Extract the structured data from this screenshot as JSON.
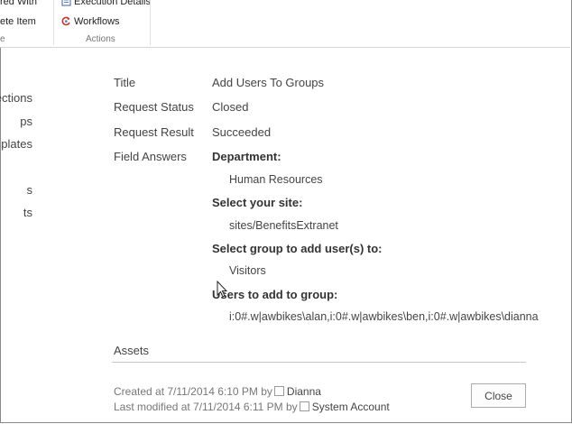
{
  "ribbon": {
    "item_shared_with": "red With",
    "item_delete": "ete Item",
    "group_left": "e",
    "item_execution": "Execution Details",
    "item_workflows": "Workflows",
    "group_actions": "Actions"
  },
  "leftnav": [
    "ections",
    "ps",
    "plates",
    "s",
    "ts"
  ],
  "fields": {
    "title_label": "Title",
    "title_value": "Add Users To Groups",
    "status_label": "Request Status",
    "status_value": "Closed",
    "result_label": "Request Result",
    "result_value": "Succeeded",
    "answers_label": "Field Answers"
  },
  "answers": [
    {
      "question": "Department:",
      "answer": "Human Resources"
    },
    {
      "question": "Select your site:",
      "answer": "sites/BenefitsExtranet"
    },
    {
      "question": "Select group to add user(s) to:",
      "answer": "Visitors"
    },
    {
      "question": "Users to add to group:",
      "answer": "i:0#.w|awbikes\\alan,i:0#.w|awbikes\\ben,i:0#.w|awbikes\\dianna"
    }
  ],
  "assets_title": "Assets",
  "meta": {
    "created_prefix": "Created at 7/11/2014 6:10 PM  by",
    "created_by": "Dianna",
    "modified_prefix": "Last modified at 7/11/2014 6:11 PM  by",
    "modified_by": "System Account"
  },
  "close_label": "Close",
  "colors": {
    "workflows_icon": "#c0392b",
    "execution_icon": "#5b7fb4"
  }
}
